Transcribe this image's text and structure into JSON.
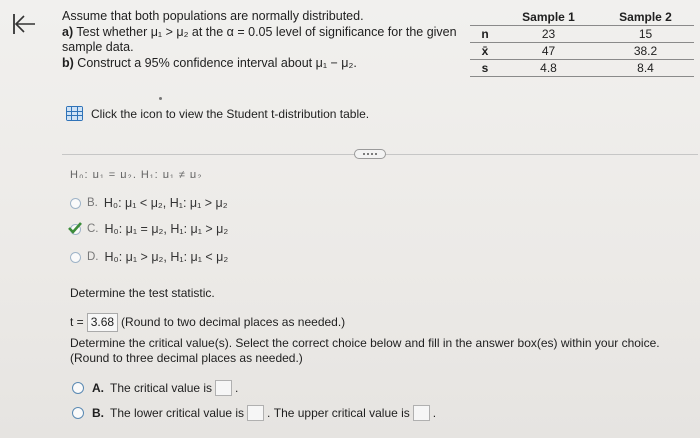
{
  "problem": {
    "line1": "Assume that both populations are normally distributed.",
    "part_a_label": "a)",
    "part_a_text": "Test whether μ₁ > μ₂ at the α = 0.05 level of significance for the given",
    "part_a_cont": "sample data.",
    "part_b_label": "b)",
    "part_b_text": "Construct a 95% confidence interval about μ₁ − μ₂."
  },
  "data_table": {
    "headers": [
      "",
      "Sample 1",
      "Sample 2"
    ],
    "rows": [
      {
        "label": "n",
        "s1": "23",
        "s2": "15"
      },
      {
        "label": "x̄",
        "s1": "47",
        "s2": "38.2"
      },
      {
        "label": "s",
        "s1": "4.8",
        "s2": "8.4"
      }
    ]
  },
  "table_link": {
    "label": "Click the icon to view the Student t-distribution table."
  },
  "truncated_option": "H₀: μ₁ = μ₂, H₁: μ₁ ≠ μ₂",
  "options": [
    {
      "letter": "B.",
      "text": "H₀: μ₁ < μ₂, H₁: μ₁ > μ₂"
    },
    {
      "letter": "C.",
      "text": "H₀: μ₁ = μ₂, H₁: μ₁ > μ₂"
    },
    {
      "letter": "D.",
      "text": "H₀: μ₁ > μ₂, H₁: μ₁ < μ₂"
    }
  ],
  "test_statistic": {
    "prompt": "Determine the test statistic.",
    "prefix": "t =",
    "value": "3.68",
    "hint": "(Round to two decimal places as needed.)"
  },
  "critical": {
    "prompt_line1": "Determine the critical value(s). Select the correct choice below and fill in the answer box(es) within your choice.",
    "prompt_line2": "(Round to three decimal places as needed.)",
    "choice_a_letter": "A.",
    "choice_a_text": "The critical value is",
    "choice_b_letter": "B.",
    "choice_b_text1": "The lower critical value is",
    "choice_b_text2": "The upper critical value is"
  },
  "colors": {
    "accent": "#2f73b8",
    "check": "#3c8c3a"
  }
}
